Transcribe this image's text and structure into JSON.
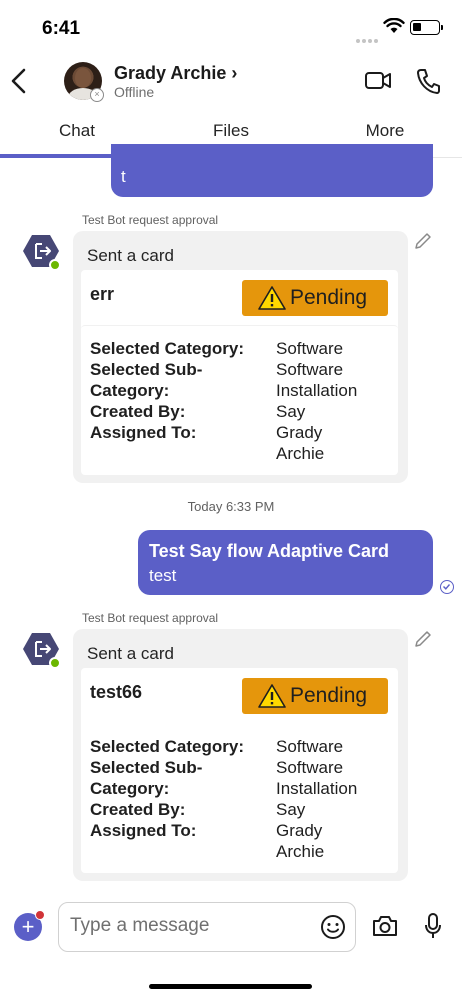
{
  "status_bar": {
    "time": "6:41"
  },
  "header": {
    "back_icon": "chevron-left-icon",
    "contact_name": "Grady Archie ›",
    "contact_status": "Offline",
    "video_icon": "video-camera-icon",
    "call_icon": "phone-icon"
  },
  "tabs": [
    {
      "label": "Chat",
      "active": true
    },
    {
      "label": "Files",
      "active": false
    },
    {
      "label": "More",
      "active": false
    }
  ],
  "accent_color": "#5b5fc7",
  "messages": [
    {
      "type": "mine-partial",
      "text": "t"
    },
    {
      "type": "bot-card",
      "sender": "Test Bot request approval",
      "header": "Sent a card",
      "card_title": "err",
      "status": "Pending",
      "status_color": "#e5960c",
      "facts": {
        "keys": [
          "Selected Category:",
          "Selected Sub-",
          "Category:",
          "Created By:",
          "Assigned To:"
        ],
        "values": [
          "Software",
          "Software",
          "Installation",
          "Say",
          "Grady",
          "Archie"
        ]
      }
    },
    {
      "type": "timestamp",
      "text": "Today 6:33 PM"
    },
    {
      "type": "mine",
      "title": "Test Say flow Adaptive Card",
      "body": "test"
    },
    {
      "type": "bot-card",
      "sender": "Test Bot request approval",
      "header": "Sent a card",
      "card_title": "test66",
      "status": "Pending",
      "status_color": "#e5960c",
      "facts": {
        "keys": [
          "Selected Category:",
          "Selected Sub-",
          "Category:",
          "Created By:",
          "Assigned To:"
        ],
        "values": [
          "Software",
          "Software",
          "Installation",
          "Say",
          "Grady",
          "Archie"
        ]
      }
    }
  ],
  "composer": {
    "placeholder": "Type a message",
    "icons": [
      "plus-icon",
      "emoji-icon",
      "camera-icon",
      "microphone-icon"
    ]
  }
}
